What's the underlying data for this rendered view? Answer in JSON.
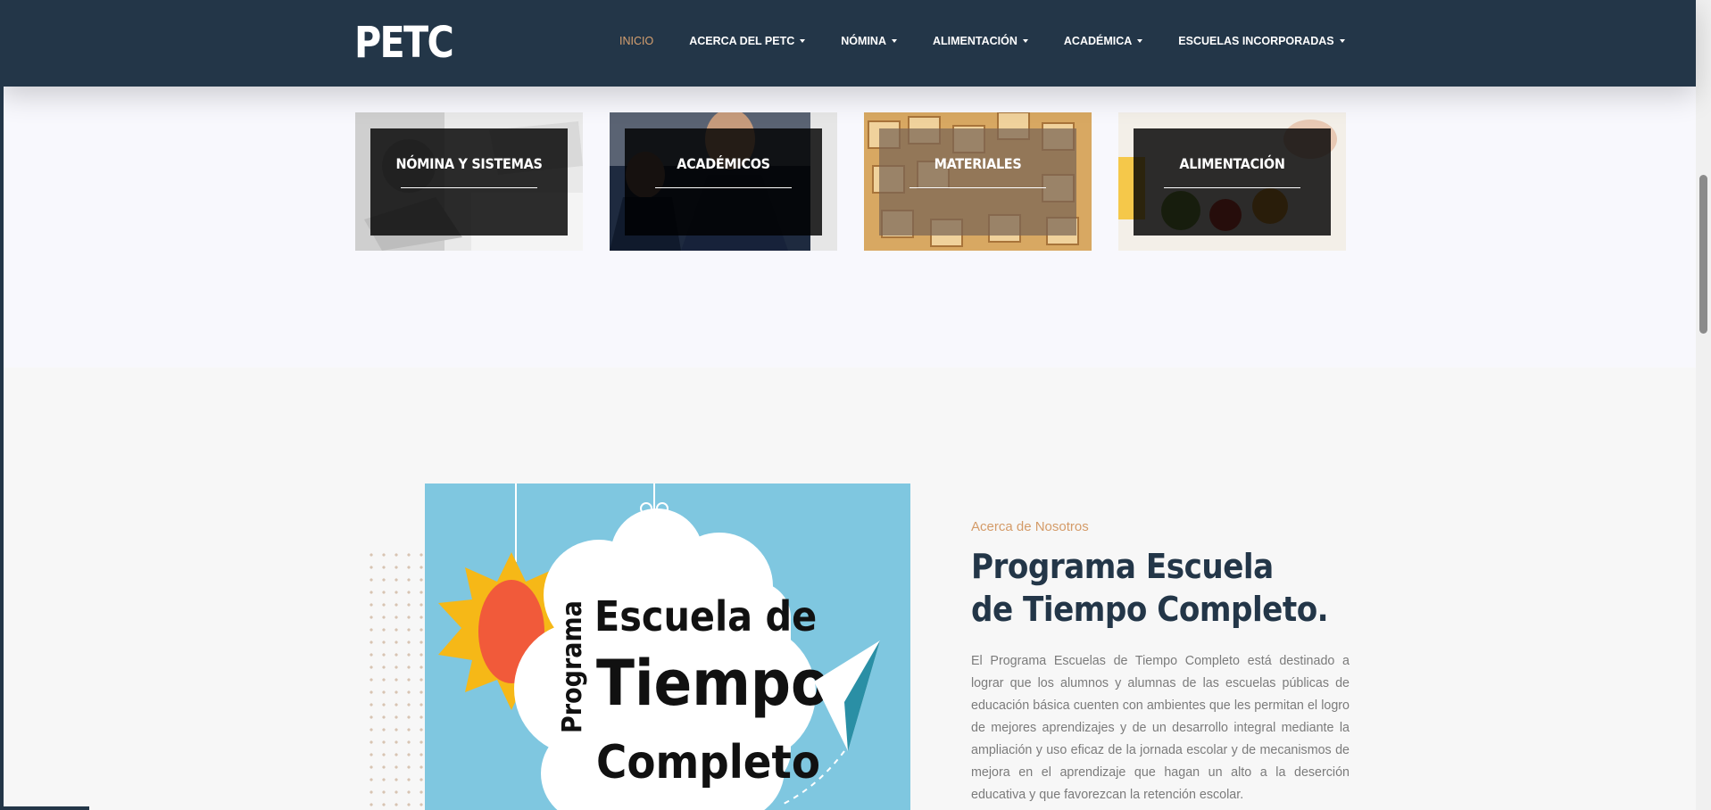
{
  "header": {
    "logo": "PETC",
    "nav": [
      {
        "label": "INICIO",
        "active": true,
        "dropdown": false
      },
      {
        "label": "ACERCA DEL PETC",
        "active": false,
        "dropdown": true
      },
      {
        "label": "NÓMINA",
        "active": false,
        "dropdown": true
      },
      {
        "label": "ALIMENTACIÓN",
        "active": false,
        "dropdown": true
      },
      {
        "label": "ACADÉMICA",
        "active": false,
        "dropdown": true
      },
      {
        "label": "ESCUELAS INCORPORADAS",
        "active": false,
        "dropdown": true
      }
    ]
  },
  "cards": [
    {
      "title": "NÓMINA Y SISTEMAS"
    },
    {
      "title": "ACADÉMICOS"
    },
    {
      "title": "MATERIALES"
    },
    {
      "title": "ALIMENTACIÓN"
    }
  ],
  "about": {
    "eyebrow": "Acerca de Nosotros",
    "title_line1": "Programa Escuela",
    "title_line2": "de Tiempo Completo.",
    "body": "El Programa Escuelas de Tiempo Completo está destinado a lograr que los alumnos y alumnas de las escuelas públicas de educación básica cuenten con ambientes que les permitan el logro de mejores aprendizajes y de un desarrollo integral mediante la ampliación y uso eficaz de la jornada escolar y de mecanismos de mejora en el aprendizaje que hagan un alto a la deserción educativa y que favorezcan la retención escolar.",
    "image": {
      "line1": "Programa",
      "line2": "Escuela de",
      "line3": "Tiempo",
      "line4": "Completo"
    }
  },
  "colors": {
    "navy": "#233648",
    "accent": "#d6a06f",
    "sky": "#7fc7e0"
  }
}
